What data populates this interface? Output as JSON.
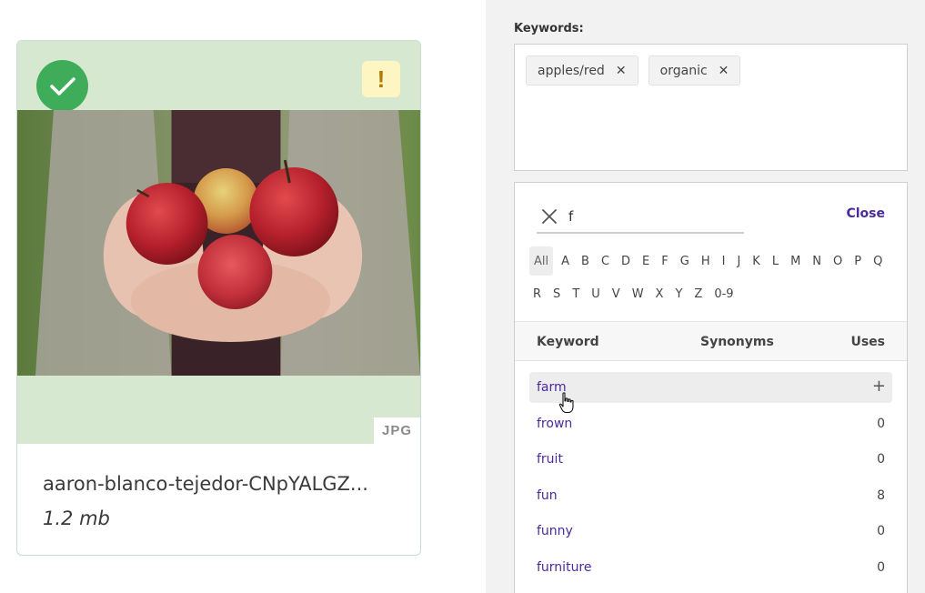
{
  "asset": {
    "filename": "aaron-blanco-tejedor-CNpYALGZ...",
    "size": "1.2 mb",
    "extension": "JPG",
    "warning_symbol": "!",
    "status_color": "#3fac5a",
    "card_bg_color": "#d6e8cf"
  },
  "keywords": {
    "label": "Keywords:",
    "tags": [
      {
        "label": "apples/red"
      },
      {
        "label": "organic"
      }
    ]
  },
  "picker": {
    "search_value": "f",
    "close_label": "Close",
    "letters_row1": [
      "All",
      "A",
      "B",
      "C",
      "D",
      "E",
      "F",
      "G",
      "H",
      "I",
      "J",
      "K",
      "L",
      "M",
      "N",
      "O",
      "P",
      "Q"
    ],
    "letters_row2": [
      "R",
      "S",
      "T",
      "U",
      "V",
      "W",
      "X",
      "Y",
      "Z",
      "0-9"
    ],
    "active_letter": "All",
    "columns": {
      "keyword": "Keyword",
      "synonyms": "Synonyms",
      "uses": "Uses"
    },
    "rows": [
      {
        "keyword": "farm",
        "uses": "",
        "hovered": true
      },
      {
        "keyword": "frown",
        "uses": "0"
      },
      {
        "keyword": "fruit",
        "uses": "0"
      },
      {
        "keyword": "fun",
        "uses": "8"
      },
      {
        "keyword": "funny",
        "uses": "0"
      },
      {
        "keyword": "furniture",
        "uses": "0"
      }
    ],
    "accent_color": "#4a2a9c"
  }
}
